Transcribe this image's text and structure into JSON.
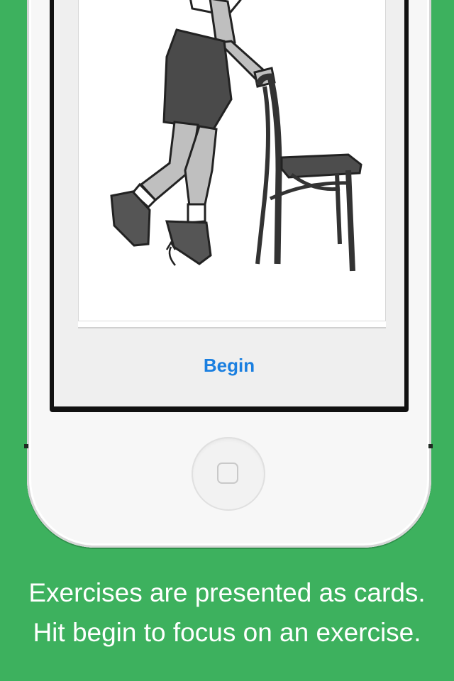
{
  "screen": {
    "begin_label": "Begin"
  },
  "caption": {
    "line1": "Exercises are presented as cards.",
    "line2": "Hit begin to focus on an exercise."
  },
  "illustration": {
    "description_icon": "person-holding-chair-leg-raise-illustration"
  },
  "colors": {
    "background": "#3db15e",
    "accent": "#1a7fe0"
  }
}
